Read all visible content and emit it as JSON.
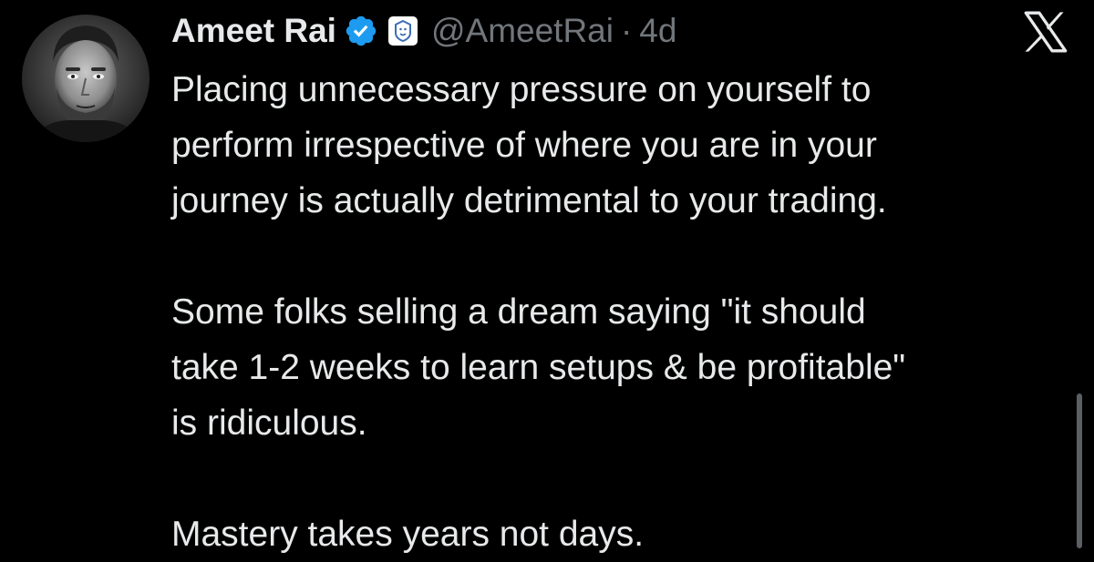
{
  "tweet": {
    "author": {
      "display_name": "Ameet Rai",
      "handle": "@AmeetRai",
      "avatar_icon": "profile-photo",
      "verified_icon": "verified-badge-icon",
      "affiliate_icon": "lion-affiliate-badge-icon"
    },
    "separator": "·",
    "time": "4d",
    "body": {
      "p1": [
        "Placing unnecessary pressure on yourself to",
        "perform irrespective of where you are in your",
        "journey is actually detrimental to your trading."
      ],
      "p2": [
        "Some folks selling a dream saying \"it should",
        "take 1-2 weeks to learn setups & be profitable\"",
        "is ridiculous."
      ],
      "p3": [
        "Mastery takes years not days."
      ]
    }
  },
  "platform_logo": "x-logo-icon",
  "colors": {
    "background": "#000000",
    "primary_text": "#e7e9ea",
    "secondary_text": "#71767b",
    "verified_blue": "#1d9bf0"
  }
}
